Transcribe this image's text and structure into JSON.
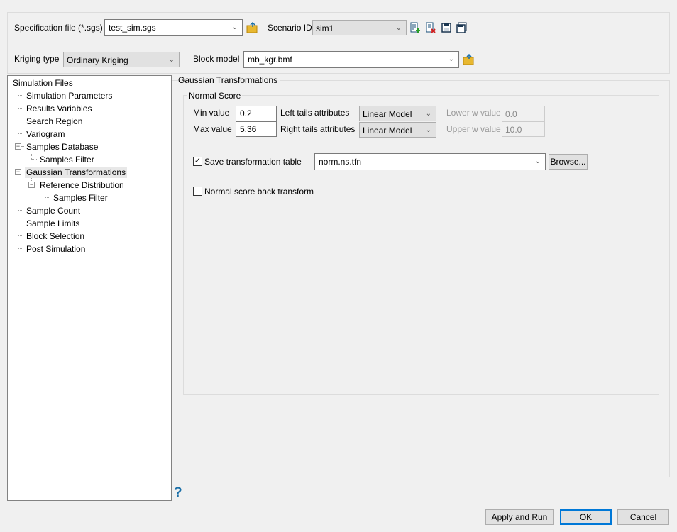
{
  "header": {
    "spec_label": "Specification file (*.sgs)",
    "spec_value": "test_sim.sgs",
    "scenario_label": "Scenario ID",
    "scenario_value": "sim1",
    "kriging_label": "Kriging type",
    "kriging_value": "Ordinary Kriging",
    "block_label": "Block model",
    "block_value": "mb_kgr.bmf"
  },
  "tree": {
    "root": "Simulation Files",
    "items": [
      "Simulation Parameters",
      "Results Variables",
      "Search Region",
      "Variogram",
      "Samples Database",
      "Samples Filter",
      "Gaussian Transformations",
      "Reference Distribution",
      "Samples Filter",
      "Sample Count",
      "Sample Limits",
      "Block Selection",
      "Post Simulation"
    ],
    "selected": "Gaussian Transformations"
  },
  "panel": {
    "title": "Gaussian Transformations",
    "group_title": "Normal Score",
    "min_label": "Min value",
    "min_value": "0.2",
    "max_label": "Max value",
    "max_value": "5.36",
    "left_tails_label": "Left tails attributes",
    "left_tails_value": "Linear Model",
    "right_tails_label": "Right tails attributes",
    "right_tails_value": "Linear Model",
    "lower_w_label": "Lower w value",
    "lower_w_value": "0.0",
    "upper_w_label": "Upper w value",
    "upper_w_value": "10.0",
    "save_table_label": "Save transformation table",
    "save_table_checked": true,
    "save_table_value": "norm.ns.tfn",
    "browse_label": "Browse...",
    "back_transform_label": "Normal score back transform",
    "back_transform_checked": false
  },
  "footer": {
    "help": "?",
    "apply_run": "Apply and Run",
    "ok": "OK",
    "cancel": "Cancel"
  },
  "colors": {
    "accent": "#0078d7",
    "help": "#1a6fa8",
    "folder": "#e8b830"
  }
}
